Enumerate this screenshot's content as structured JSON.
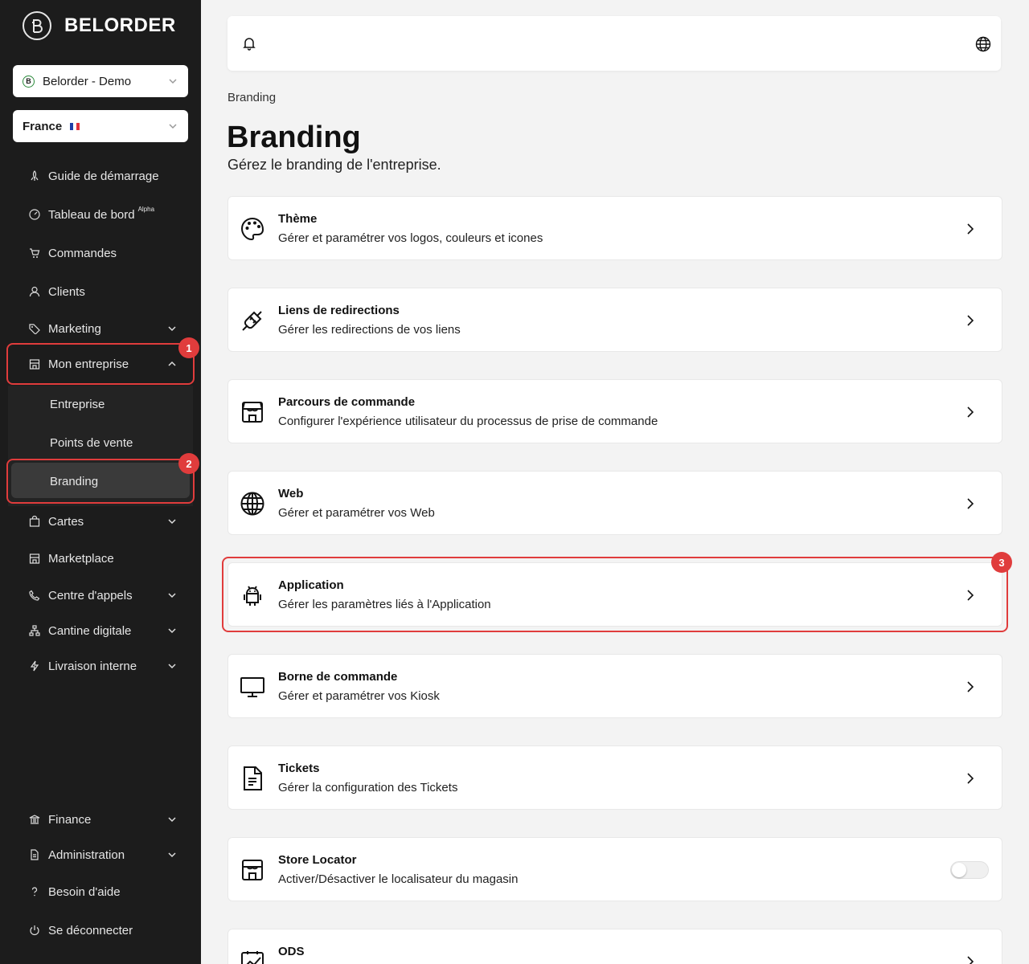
{
  "brand": {
    "name": "BELORDER"
  },
  "org_select": {
    "value": "Belorder - Demo"
  },
  "country_select": {
    "value": "France"
  },
  "sidebar": {
    "items": [
      {
        "label": "Guide de démarrage",
        "icon": "rocket-icon"
      },
      {
        "label": "Tableau de bord",
        "badge": "Alpha",
        "icon": "gauge-icon"
      },
      {
        "label": "Commandes",
        "icon": "cart-icon"
      },
      {
        "label": "Clients",
        "icon": "user-icon"
      },
      {
        "label": "Marketing",
        "icon": "tag-icon"
      },
      {
        "label": "Mon entreprise",
        "icon": "store-icon"
      },
      {
        "label": "Cartes",
        "icon": "bag-icon"
      },
      {
        "label": "Marketplace",
        "icon": "storefront-icon"
      },
      {
        "label": "Centre d'appels",
        "icon": "phone-icon"
      },
      {
        "label": "Cantine digitale",
        "icon": "hierarchy-icon"
      },
      {
        "label": "Livraison interne",
        "icon": "bolt-icon"
      }
    ],
    "sub_items": [
      {
        "label": "Entreprise"
      },
      {
        "label": "Points de vente"
      },
      {
        "label": "Branding"
      }
    ],
    "bottom_items": [
      {
        "label": "Finance",
        "icon": "bank-icon"
      },
      {
        "label": "Administration",
        "icon": "document-icon"
      },
      {
        "label": "Besoin d'aide",
        "icon": "question-icon"
      },
      {
        "label": "Se déconnecter",
        "icon": "power-icon"
      }
    ]
  },
  "annotations": [
    "1",
    "2",
    "3"
  ],
  "breadcrumb": "Branding",
  "page": {
    "title": "Branding",
    "subtitle": "Gérez le branding de l'entreprise."
  },
  "cards": [
    {
      "title": "Thème",
      "desc": "Gérer et paramétrer vos logos, couleurs et icones",
      "icon": "palette-icon"
    },
    {
      "title": "Liens de redirections",
      "desc": "Gérer les redirections de vos liens",
      "icon": "plug-icon"
    },
    {
      "title": "Parcours de commande",
      "desc": "Configurer l'expérience utilisateur du processus de prise de commande",
      "icon": "shop-icon"
    },
    {
      "title": "Web",
      "desc": "Gérer et paramétrer vos Web",
      "icon": "globe-icon"
    },
    {
      "title": "Application",
      "desc": "Gérer les paramètres liés à l'Application",
      "icon": "android-icon"
    },
    {
      "title": "Borne de commande",
      "desc": "Gérer et paramétrer vos Kiosk",
      "icon": "monitor-icon"
    },
    {
      "title": "Tickets",
      "desc": "Gérer la configuration des Tickets",
      "icon": "ticket-icon"
    },
    {
      "title": "Store Locator",
      "desc": "Activer/Désactiver le localisateur du magasin",
      "icon": "store-icon",
      "toggle": false
    },
    {
      "title": "ODS",
      "desc": "",
      "icon": "chart-icon"
    }
  ],
  "colors": {
    "sidebar": "#1c1c1c",
    "highlight": "#e03c3c",
    "background": "#f3f3f3"
  }
}
